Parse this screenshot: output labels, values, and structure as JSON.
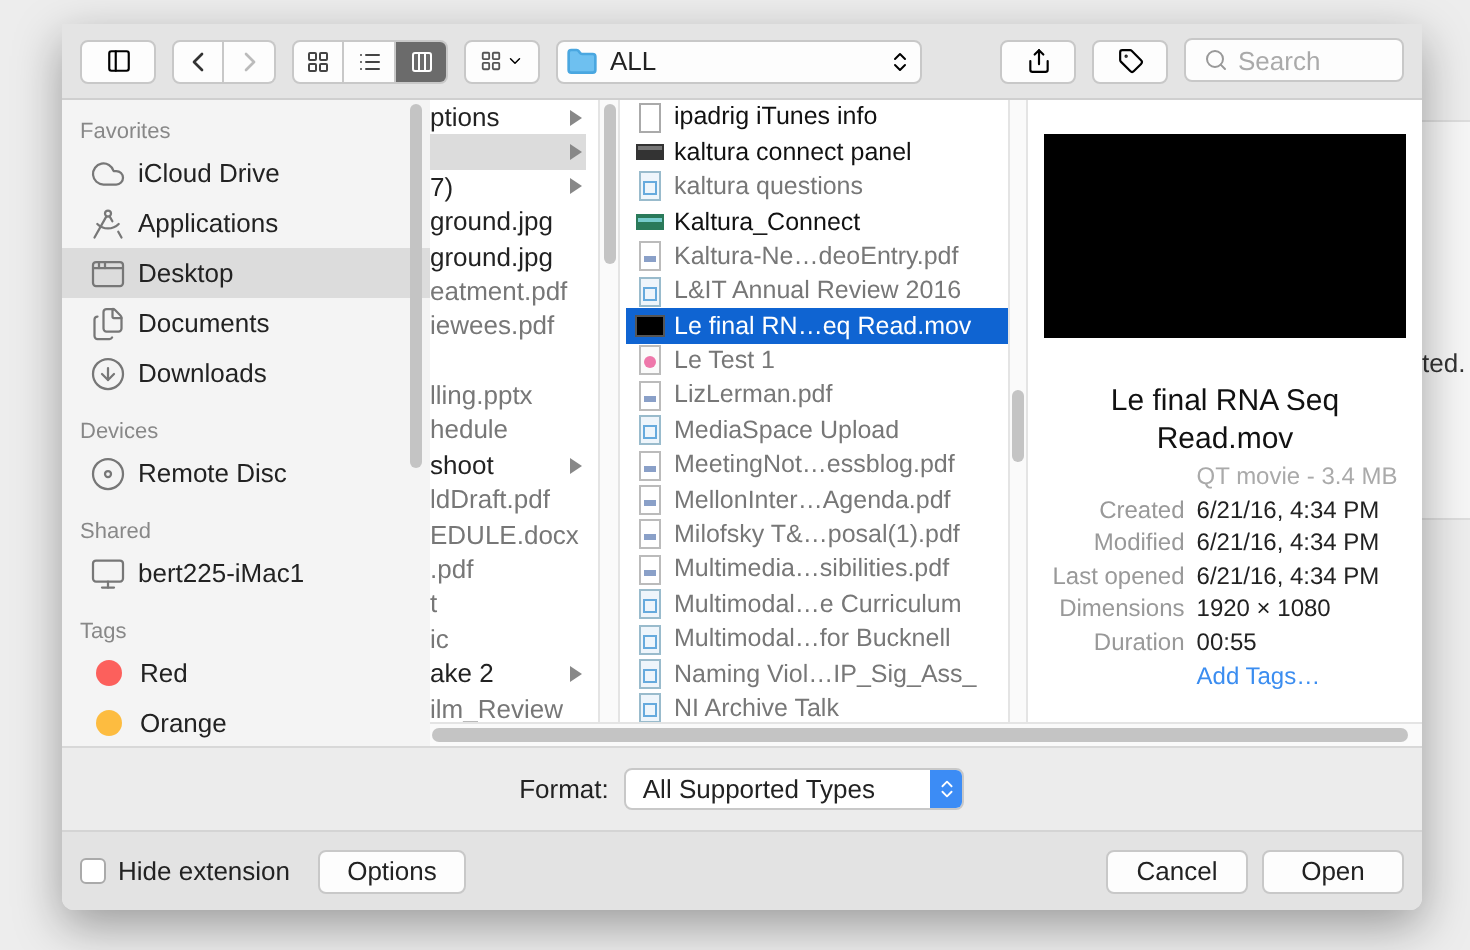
{
  "background_text": "ted.",
  "toolbar": {
    "back_disabled": false,
    "forward_disabled": true,
    "view_modes": [
      {
        "kind": "icon",
        "selected": false
      },
      {
        "kind": "list",
        "selected": false
      },
      {
        "kind": "column",
        "selected": true
      }
    ],
    "path": "ALL",
    "search": {
      "placeholder": "Search"
    }
  },
  "sidebar": {
    "sections": [
      {
        "title": "Favorites",
        "items": [
          {
            "label": "iCloud Drive",
            "kind": "cloud",
            "selected": false
          },
          {
            "label": "Applications",
            "kind": "apps",
            "selected": false
          },
          {
            "label": "Desktop",
            "kind": "desktop",
            "selected": true
          },
          {
            "label": "Documents",
            "kind": "documents",
            "selected": false
          },
          {
            "label": "Downloads",
            "kind": "downloads",
            "selected": false
          }
        ]
      },
      {
        "title": "Devices",
        "items": [
          {
            "label": "Remote Disc",
            "kind": "disc",
            "selected": false
          }
        ]
      },
      {
        "title": "Shared",
        "items": [
          {
            "label": "bert225-iMac1",
            "kind": "computer",
            "selected": false
          }
        ]
      },
      {
        "title": "Tags",
        "items": [
          {
            "label": "Red",
            "kind": "tag",
            "color": "#fc605c",
            "selected": false
          },
          {
            "label": "Orange",
            "kind": "tag",
            "color": "#fdbc40",
            "selected": false
          }
        ]
      }
    ]
  },
  "column_1": [
    {
      "label": "ptions",
      "folder": true,
      "dim": false,
      "selected": false
    },
    {
      "folder": true,
      "dim": false,
      "selected": true
    },
    {
      "label": "7)",
      "folder": true,
      "dim": false,
      "selected": false
    },
    {
      "label": "ground.jpg",
      "folder": false,
      "dim": false,
      "selected": false
    },
    {
      "label": "ground.jpg",
      "folder": false,
      "dim": false,
      "selected": false
    },
    {
      "label": "eatment.pdf",
      "folder": false,
      "dim": true,
      "selected": false
    },
    {
      "label": "iewees.pdf",
      "folder": false,
      "dim": true,
      "selected": false
    },
    {
      "selected": false
    },
    {
      "label": "lling.pptx",
      "folder": false,
      "dim": true,
      "selected": false
    },
    {
      "label": "hedule",
      "folder": false,
      "dim": true,
      "selected": false
    },
    {
      "label": "shoot",
      "folder": true,
      "dim": false,
      "selected": false
    },
    {
      "label": "ldDraft.pdf",
      "folder": false,
      "dim": true,
      "selected": false
    },
    {
      "label": "EDULE.docx",
      "folder": false,
      "dim": true,
      "selected": false
    },
    {
      "label": ".pdf",
      "folder": false,
      "dim": true,
      "selected": false
    },
    {
      "label": "t",
      "folder": false,
      "dim": true,
      "selected": false
    },
    {
      "label": "ic",
      "folder": false,
      "dim": true,
      "selected": false
    },
    {
      "label": "ake 2",
      "folder": true,
      "dim": false,
      "selected": false
    },
    {
      "label": "ilm_Review",
      "folder": false,
      "dim": true,
      "selected": false
    }
  ],
  "column_2": [
    {
      "label": "ipadrig iTunes info",
      "kind": "blank",
      "dim": false,
      "selected": false
    },
    {
      "label": "kaltura connect panel",
      "kind": "dark-thumb",
      "dim": false,
      "selected": false
    },
    {
      "label": "kaltura questions",
      "kind": "text",
      "dim": true,
      "selected": false
    },
    {
      "label": "Kaltura_Connect",
      "kind": "green-thumb",
      "dim": false,
      "selected": false
    },
    {
      "label": "Kaltura-Ne…deoEntry.pdf",
      "kind": "pdf",
      "dim": true,
      "selected": false
    },
    {
      "label": "L&IT Annual Review 2016",
      "kind": "text",
      "dim": true,
      "selected": false
    },
    {
      "label": "Le final RN…eq Read.mov",
      "kind": "movie",
      "selected": true
    },
    {
      "label": "Le Test 1",
      "kind": "image",
      "dim": true,
      "selected": false
    },
    {
      "label": "LizLerman.pdf",
      "kind": "pdf",
      "dim": true,
      "selected": false
    },
    {
      "label": "MediaSpace Upload",
      "kind": "text",
      "dim": true,
      "selected": false
    },
    {
      "label": "MeetingNot…essblog.pdf",
      "kind": "pdf",
      "dim": true,
      "selected": false
    },
    {
      "label": "MellonInter…Agenda.pdf",
      "kind": "pdf",
      "dim": true,
      "selected": false
    },
    {
      "label": "Milofsky T&…posal(1).pdf",
      "kind": "pdf",
      "dim": true,
      "selected": false
    },
    {
      "label": "Multimedia…sibilities.pdf",
      "kind": "pdf",
      "dim": true,
      "selected": false
    },
    {
      "label": "Multimodal…e Curriculum",
      "kind": "text",
      "dim": true,
      "selected": false
    },
    {
      "label": "Multimodal…for Bucknell",
      "kind": "text",
      "dim": true,
      "selected": false
    },
    {
      "label": "Naming Viol…IP_Sig_Ass_",
      "kind": "text",
      "dim": true,
      "selected": false
    },
    {
      "label": "NI Archive Talk",
      "kind": "text",
      "dim": true,
      "selected": false
    }
  ],
  "preview": {
    "name": "Le final RNA Seq Read.mov",
    "kind": "QT movie - 3.4 MB",
    "details": [
      {
        "label": "Created",
        "value": "6/21/16, 4:34 PM"
      },
      {
        "label": "Modified",
        "value": "6/21/16, 4:34 PM"
      },
      {
        "label": "Last opened",
        "value": "6/21/16, 4:34 PM"
      },
      {
        "label": "Dimensions",
        "value": "1920 × 1080"
      },
      {
        "label": "Duration",
        "value": "00:55"
      }
    ],
    "add_tags": "Add Tags…"
  },
  "format": {
    "label": "Format:",
    "value": "All Supported Types"
  },
  "hide_extension": {
    "label": "Hide extension",
    "checked": false
  },
  "buttons": [
    "Options",
    "Cancel",
    "Open"
  ]
}
